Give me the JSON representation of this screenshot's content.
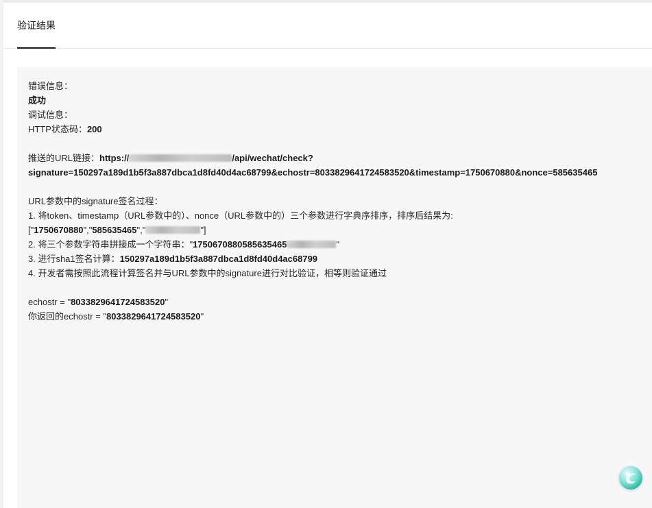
{
  "tabs": [
    {
      "label": "验证结果",
      "active": true
    }
  ],
  "result": {
    "error_label": "错误信息：",
    "error_value": "成功",
    "debug_label": "调试信息：",
    "http_label": "HTTP状态码：",
    "http_value": "200",
    "url_label": "推送的URL链接：",
    "url_prefix": "https://",
    "url_path": "/api/wechat/check?",
    "url_query": "signature=150297a189d1b5f3a887dbca1d8fd40d4ac68799&echostr=8033829641724583520&timestamp=1750670880&nonce=585635465",
    "sig_title": "URL参数中的signature签名过程：",
    "step1_text": "1. 将token、timestamp（URL参数中的）、nonce（URL参数中的）三个参数进行字典序排序，排序后结果为:",
    "sorted_open": "[\"",
    "sorted_timestamp": "1750670880",
    "sorted_sep": "\",\"",
    "sorted_nonce": "585635465",
    "sorted_sep2": "\",\"",
    "sorted_close": "\"]",
    "step2_text": "2. 将三个参数字符串拼接成一个字符串：\"",
    "step2_value": "1750670880585635465",
    "step2_close": "\"",
    "step3_text": "3. 进行sha1签名计算：",
    "step3_value": "150297a189d1b5f3a887dbca1d8fd40d4ac68799",
    "step4_text": "4. 开发者需按照此流程计算签名并与URL参数中的signature进行对比验证，相等则验证通过",
    "echostr_label": "echostr = \"",
    "echostr_value": "8033829641724583520",
    "echostr_close": "\"",
    "returned_label": "你返回的echostr = \"",
    "returned_value": "8033829641724583520",
    "returned_close": "\""
  },
  "icons": {
    "float_logo": "assistant-logo-icon",
    "accent": "#2fb9a6"
  }
}
